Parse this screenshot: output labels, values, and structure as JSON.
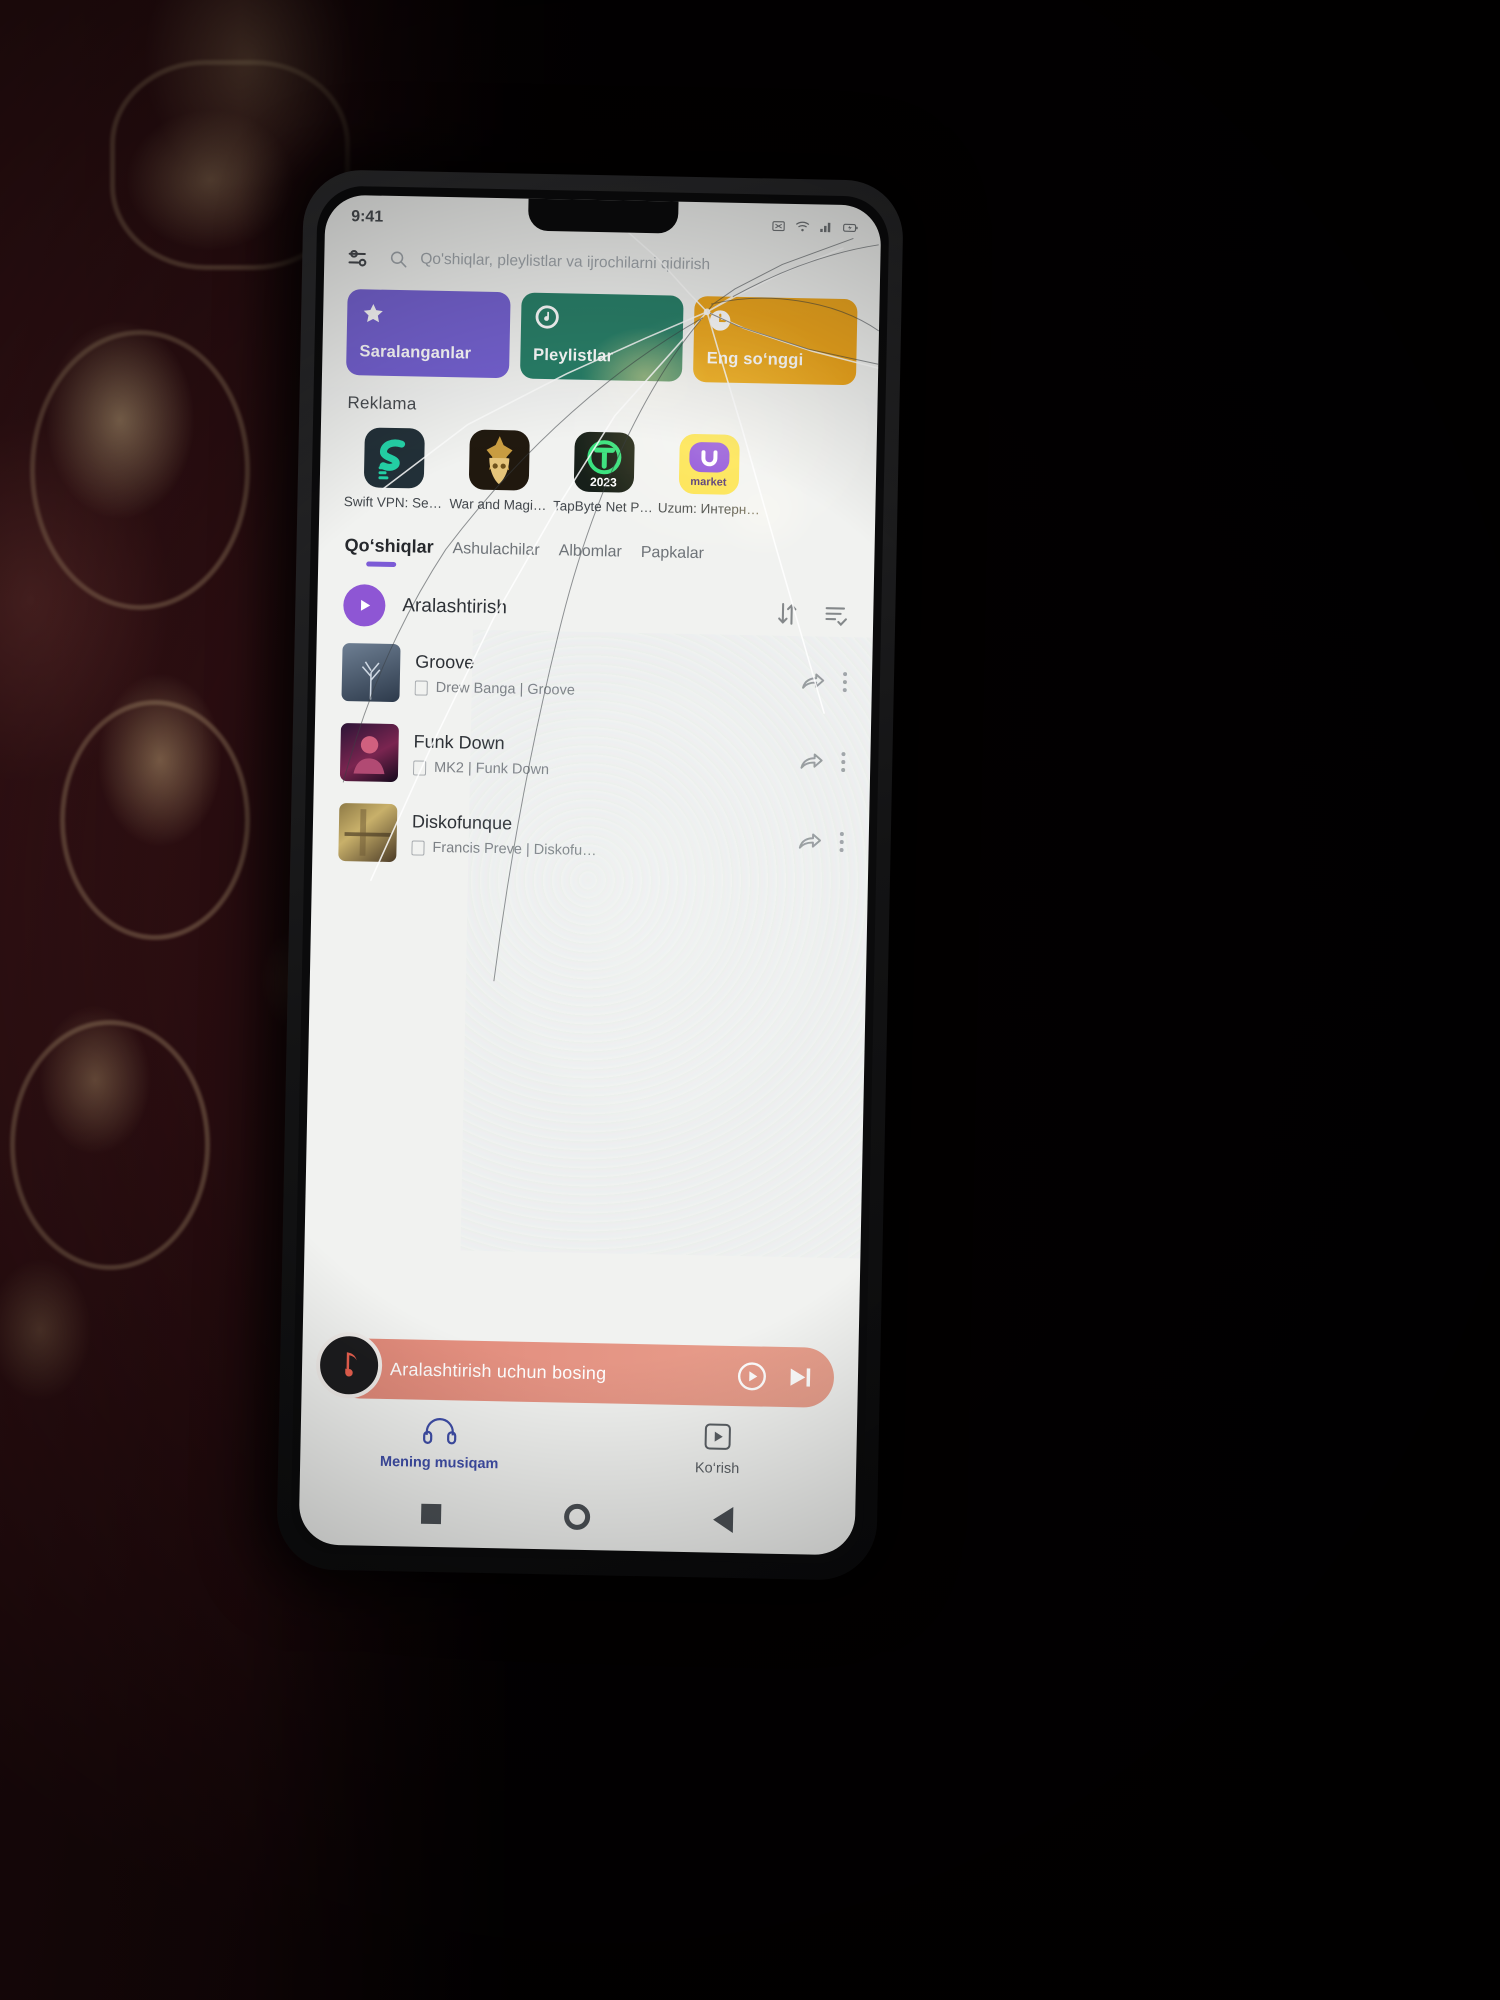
{
  "status": {
    "time": "9:41",
    "icons": [
      "no-sim-icon",
      "wifi-icon",
      "signal-icon",
      "battery-icon"
    ]
  },
  "search": {
    "filter_icon": "tune-icon",
    "search_icon": "search-icon",
    "placeholder": "Qo'shiqlar, pleylistlar va ijrochilarni qidirish"
  },
  "quick_cards": [
    {
      "label": "Saralanganlar",
      "icon": "star-icon",
      "color": "#6f5bd0"
    },
    {
      "label": "Pleylistlar",
      "icon": "disc-icon",
      "color": "#1f7a62"
    },
    {
      "label": "Eng so‘nggi",
      "icon": "clock-icon",
      "color": "#eda213"
    }
  ],
  "ads": {
    "title": "Reklama",
    "items": [
      {
        "name": "Swift VPN: Se…",
        "icon": "swift-vpn-app-icon"
      },
      {
        "name": "War and Magi…",
        "icon": "war-and-magic-app-icon"
      },
      {
        "name": "TapByte Net P…",
        "icon": "tapbyte-app-icon",
        "badge": "2023"
      },
      {
        "name": "Uzum: Интерн…",
        "icon": "uzum-market-app-icon",
        "badge": "market"
      }
    ]
  },
  "tabs": [
    {
      "label": "Qo‘shiqlar",
      "active": true
    },
    {
      "label": "Ashulachilar",
      "active": false
    },
    {
      "label": "Albomlar",
      "active": false
    },
    {
      "label": "Papkalar",
      "active": false
    }
  ],
  "list_header": {
    "shuffle_label": "Aralashtirish",
    "shuffle_icon": "play-icon",
    "sort_icon": "sort-arrows-icon",
    "queue_icon": "playlist-check-icon"
  },
  "songs": [
    {
      "title": "Groove",
      "subtitle": "Drew Banga | Groove",
      "share_icon": "share-icon",
      "menu_icon": "more-vertical-icon",
      "file_icon": "file-icon"
    },
    {
      "title": "Funk Down",
      "subtitle": "MK2 | Funk Down",
      "share_icon": "share-icon",
      "menu_icon": "more-vertical-icon",
      "file_icon": "file-icon"
    },
    {
      "title": "Diskofunque",
      "subtitle": "Francis Preve | Diskofu…",
      "share_icon": "share-icon",
      "menu_icon": "more-vertical-icon",
      "file_icon": "file-icon"
    }
  ],
  "mini_player": {
    "text": "Aralashtirish uchun bosing",
    "badge_icon": "music-note-icon",
    "play_icon": "play-circle-icon",
    "next_icon": "skip-next-icon",
    "color": "#e08f7e"
  },
  "bottom_nav": [
    {
      "label": "Mening musiqam",
      "icon": "headphones-icon",
      "active": true
    },
    {
      "label": "Ko‘rish",
      "icon": "video-play-icon",
      "active": false
    }
  ],
  "system_nav": {
    "recents_icon": "square-icon",
    "home_icon": "circle-icon",
    "back_icon": "triangle-back-icon"
  },
  "colors": {
    "accent_purple": "#7b5ad6",
    "card_purple": "#6f5bd0",
    "card_green": "#1f7a62",
    "card_yellow": "#eda213",
    "player_salmon": "#e08f7e",
    "nav_active": "#3f4ea8"
  }
}
